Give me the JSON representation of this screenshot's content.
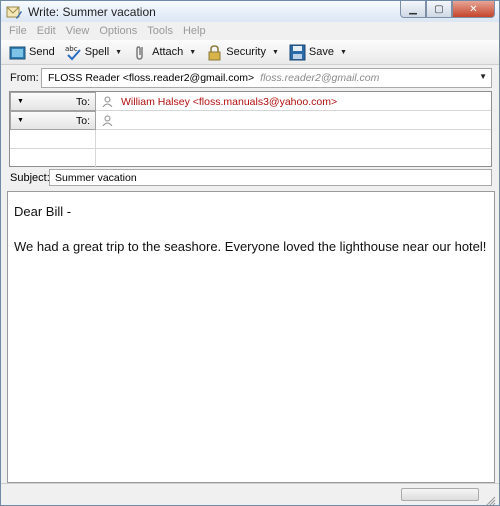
{
  "window": {
    "title": "Write: Summer vacation"
  },
  "menubar": {
    "items": [
      "File",
      "Edit",
      "View",
      "Options",
      "Tools",
      "Help"
    ]
  },
  "toolbar": {
    "send": "Send",
    "spell": "Spell",
    "attach": "Attach",
    "security": "Security",
    "save": "Save"
  },
  "from": {
    "label": "From:",
    "account": "FLOSS Reader <floss.reader2@gmail.com>",
    "alias": "floss.reader2@gmail.com"
  },
  "recipients": [
    {
      "type": "To:",
      "value": "William Halsey <floss.manuals3@yahoo.com>"
    },
    {
      "type": "To:",
      "value": ""
    }
  ],
  "subject": {
    "label": "Subject:",
    "value": "Summer vacation"
  },
  "message": {
    "lines": [
      "Dear Bill -",
      "We had a great trip to the seashore. Everyone loved the lighthouse near our hotel!"
    ]
  },
  "colors": {
    "recipient_text": "#b20e0e",
    "menu_text": "#9a9a9a"
  }
}
